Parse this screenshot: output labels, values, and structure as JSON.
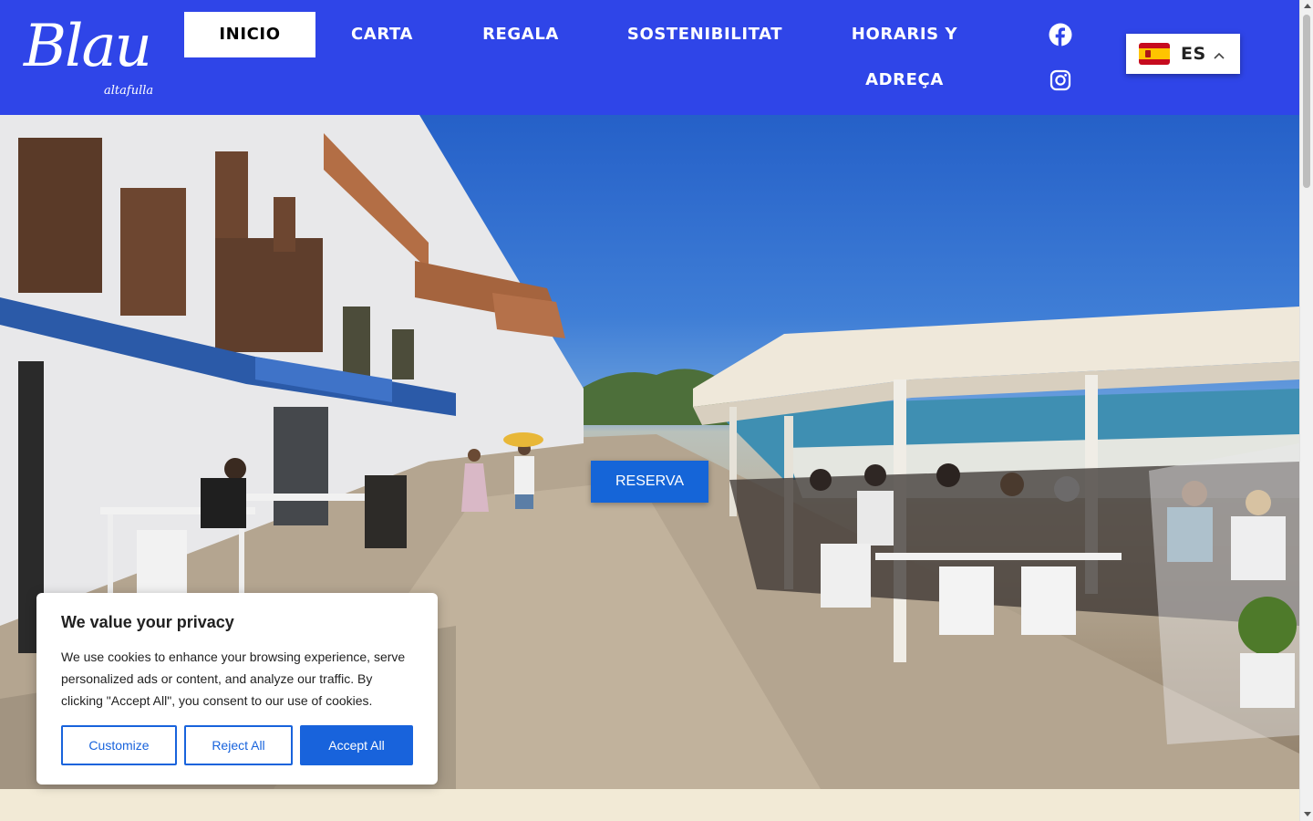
{
  "brand": {
    "logo_main": "Blau",
    "logo_sub": "altafulla"
  },
  "nav": {
    "items": [
      {
        "label": "INICIO",
        "active": true
      },
      {
        "label": "CARTA"
      },
      {
        "label": "REGALA"
      },
      {
        "label": "SOSTENIBILITAT"
      },
      {
        "label": "HORARIS Y ADREÇA"
      }
    ]
  },
  "social": {
    "icons": [
      "facebook-icon",
      "instagram-icon"
    ]
  },
  "language": {
    "code": "ES",
    "flag": "spain-flag-icon"
  },
  "hero": {
    "cta_label": "RESERVA"
  },
  "cookie_banner": {
    "title": "We value your privacy",
    "text": "We use cookies to enhance your browsing experience, serve personalized ads or content, and analyze our traffic. By clicking \"Accept All\", you consent to our use of cookies.",
    "customize_label": "Customize",
    "reject_label": "Reject All",
    "accept_label": "Accept All"
  },
  "colors": {
    "header_bg": "#2f45e8",
    "cta_bg": "#1565d8",
    "cookie_accent": "#1863dc",
    "footer_bg": "#f2ead6"
  }
}
